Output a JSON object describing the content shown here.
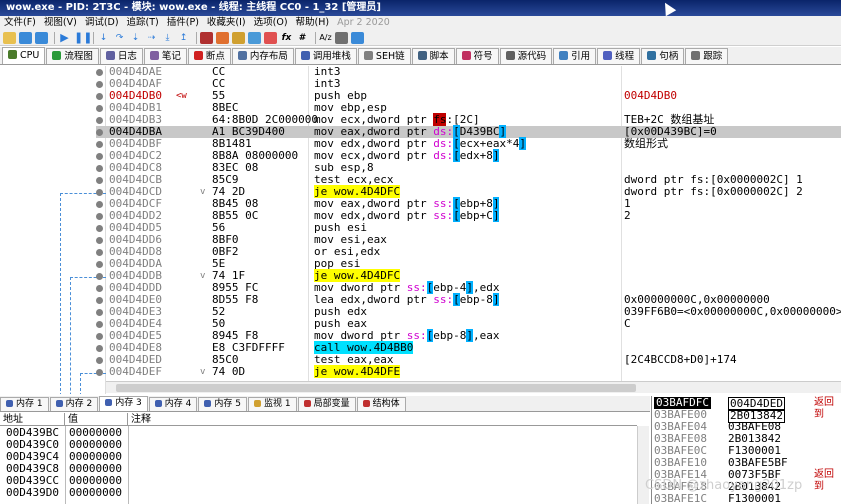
{
  "window": {
    "title": "wow.exe - PID: 2T3C - 模块: wow.exe - 线程: 主线程 CC0 - 1_32 [管理员]"
  },
  "menu": {
    "items": [
      "文件(F)",
      "视图(V)",
      "调试(D)",
      "追踪(T)",
      "插件(P)",
      "收藏夹(I)",
      "选项(O)",
      "帮助(H)"
    ],
    "date": "Apr 2 2020"
  },
  "toolbar": {
    "icons": [
      "open-icon",
      "restart-icon",
      "close-icon",
      "run-icon",
      "pause-icon",
      "step-into-icon",
      "step-over-icon",
      "trace-into-icon",
      "trace-over-icon",
      "run-to-user-icon",
      "run-to-return-icon",
      "scylla-icon",
      "patch-icon",
      "bookmark-icon",
      "comment-icon",
      "label-icon",
      "function-icon",
      "hash-icon",
      "font-icon",
      "calculator-icon",
      "help-icon"
    ],
    "text_icons": {
      "fx": "fx",
      "hash": "#",
      "az": "A/z"
    }
  },
  "tabs": [
    {
      "label": "CPU",
      "name": "tab-cpu",
      "color": "#4a7a2a"
    },
    {
      "label": "流程图",
      "name": "tab-graph",
      "color": "#2a9a3a"
    },
    {
      "label": "日志",
      "name": "tab-log",
      "color": "#6060a0"
    },
    {
      "label": "笔记",
      "name": "tab-notes",
      "color": "#8060a0"
    },
    {
      "label": "断点",
      "name": "tab-breakpoints",
      "color": "#d02020"
    },
    {
      "label": "内存布局",
      "name": "tab-memory-map",
      "color": "#5070a0"
    },
    {
      "label": "调用堆栈",
      "name": "tab-call-stack",
      "color": "#4060b0"
    },
    {
      "label": "SEH链",
      "name": "tab-seh",
      "color": "#808080"
    },
    {
      "label": "脚本",
      "name": "tab-script",
      "color": "#406080"
    },
    {
      "label": "符号",
      "name": "tab-symbols",
      "color": "#c03060"
    },
    {
      "label": "源代码",
      "name": "tab-source",
      "color": "#606060"
    },
    {
      "label": "引用",
      "name": "tab-references",
      "color": "#4080c0"
    },
    {
      "label": "线程",
      "name": "tab-threads",
      "color": "#5060c0"
    },
    {
      "label": "句柄",
      "name": "tab-handles",
      "color": "#3070a0"
    },
    {
      "label": "跟踪",
      "name": "tab-trace",
      "color": "#707070"
    }
  ],
  "disasm": [
    {
      "addr": "004D4DAE",
      "bytes": "CC",
      "asm": "int3",
      "comment": ""
    },
    {
      "addr": "004D4DAF",
      "bytes": "CC",
      "asm": "int3",
      "comment": ""
    },
    {
      "addr": "004D4DB0",
      "mark": "<w",
      "bytes": "55",
      "asm": "push ebp",
      "comment": "004D4DB0",
      "hi": true
    },
    {
      "addr": "004D4DB1",
      "bytes": "8BEC",
      "asm": "mov ebp,esp",
      "comment": ""
    },
    {
      "addr": "004D4DB3",
      "bytes": "64:8B0D 2C000000",
      "asm": "mov ecx,dword ptr fs:[2C]",
      "comment": "TEB+2C 数组基址"
    },
    {
      "addr": "004D4DBA",
      "bytes": "A1 BC39D400",
      "asm": "mov eax,dword ptr ds:[D439BC]",
      "comment": "[0x00D439BC]=0",
      "cur": true
    },
    {
      "addr": "004D4DBF",
      "bytes": "8B1481",
      "asm": "mov edx,dword ptr ds:[ecx+eax*4]",
      "comment": "数组形式"
    },
    {
      "addr": "004D4DC2",
      "bytes": "8B8A 08000000",
      "asm": "mov ecx,dword ptr ds:[edx+8]",
      "comment": ""
    },
    {
      "addr": "004D4DC8",
      "bytes": "83EC 08",
      "asm": "sub esp,8",
      "comment": ""
    },
    {
      "addr": "004D4DCB",
      "bytes": "85C9",
      "asm": "test ecx,ecx",
      "comment": "dword ptr fs:[0x0000002C] 1"
    },
    {
      "addr": "004D4DCD",
      "jmp": "v",
      "bytes": "74 2D",
      "asm": "je wow.4D4DFC",
      "comment": "dword ptr fs:[0x0000002C] 2"
    },
    {
      "addr": "004D4DCF",
      "bytes": "8B45 08",
      "asm": "mov eax,dword ptr ss:[ebp+8]",
      "comment": "1"
    },
    {
      "addr": "004D4DD2",
      "bytes": "8B55 0C",
      "asm": "mov edx,dword ptr ss:[ebp+C]",
      "comment": "2"
    },
    {
      "addr": "004D4DD5",
      "bytes": "56",
      "asm": "push esi",
      "comment": ""
    },
    {
      "addr": "004D4DD6",
      "bytes": "8BF0",
      "asm": "mov esi,eax",
      "comment": ""
    },
    {
      "addr": "004D4DD8",
      "bytes": "0BF2",
      "asm": "or esi,edx",
      "comment": ""
    },
    {
      "addr": "004D4DDA",
      "bytes": "5E",
      "asm": "pop esi",
      "comment": ""
    },
    {
      "addr": "004D4DDB",
      "jmp": "v",
      "bytes": "74 1F",
      "asm": "je wow.4D4DFC",
      "comment": ""
    },
    {
      "addr": "004D4DDD",
      "bytes": "8955 FC",
      "asm": "mov dword ptr ss:[ebp-4],edx",
      "comment": ""
    },
    {
      "addr": "004D4DE0",
      "bytes": "8D55 F8",
      "asm": "lea edx,dword ptr ss:[ebp-8]",
      "comment": "0x00000000C,0x00000000"
    },
    {
      "addr": "004D4DE3",
      "bytes": "52",
      "asm": "push edx",
      "comment": "039FF6B0=<0x00000000C,0x00000000>"
    },
    {
      "addr": "004D4DE4",
      "bytes": "50",
      "asm": "push eax",
      "comment": "C"
    },
    {
      "addr": "004D4DE5",
      "bytes": "8945 F8",
      "asm": "mov dword ptr ss:[ebp-8],eax",
      "comment": ""
    },
    {
      "addr": "004D4DE8",
      "bytes": "E8 C3FDFFFF",
      "asm": "call wow.4D4BB0",
      "comment": ""
    },
    {
      "addr": "004D4DED",
      "bytes": "85C0",
      "asm": "test eax,eax",
      "comment": "[2C4BCCD8+D0]+174"
    },
    {
      "addr": "004D4DEF",
      "jmp": "v",
      "bytes": "74 0D",
      "asm": "je wow.4D4DFE",
      "comment": ""
    }
  ],
  "bottom_tabs": [
    "内存 1",
    "内存 2",
    "内存 3",
    "内存 4",
    "内存 5",
    "监视 1",
    "局部变量",
    "结构体"
  ],
  "dump": {
    "headers": {
      "address": "地址",
      "value": "值",
      "comment": "注释"
    },
    "rows": [
      {
        "addr": "00D439BC",
        "value": "00000000"
      },
      {
        "addr": "00D439C0",
        "value": "00000000"
      },
      {
        "addr": "00D439C4",
        "value": "00000000"
      },
      {
        "addr": "00D439C8",
        "value": "00000000"
      },
      {
        "addr": "00D439CC",
        "value": "00000000"
      },
      {
        "addr": "00D439D0",
        "value": "00000000"
      }
    ]
  },
  "stack": {
    "rows": [
      {
        "addr": "03BAFDFC",
        "value": "004D4DED",
        "comment": "返回到",
        "sel": true
      },
      {
        "addr": "03BAFE00",
        "value": "2B013842",
        "comment": ""
      },
      {
        "addr": "03BAFE04",
        "value": "03BAFE08",
        "comment": ""
      },
      {
        "addr": "03BAFE08",
        "value": "2B013842",
        "comment": ""
      },
      {
        "addr": "03BAFE0C",
        "value": "F1300001",
        "comment": ""
      },
      {
        "addr": "03BAFE10",
        "value": "03BAFE5BF",
        "comment": ""
      },
      {
        "addr": "03BAFE14",
        "value": "0073F5BF",
        "comment": "返回到"
      },
      {
        "addr": "03BAFE18",
        "value": "2B013842",
        "comment": ""
      },
      {
        "addr": "03BAFE1C",
        "value": "F1300001",
        "comment": ""
      }
    ]
  },
  "watermark": "CSDN @zhaoyang201zp"
}
